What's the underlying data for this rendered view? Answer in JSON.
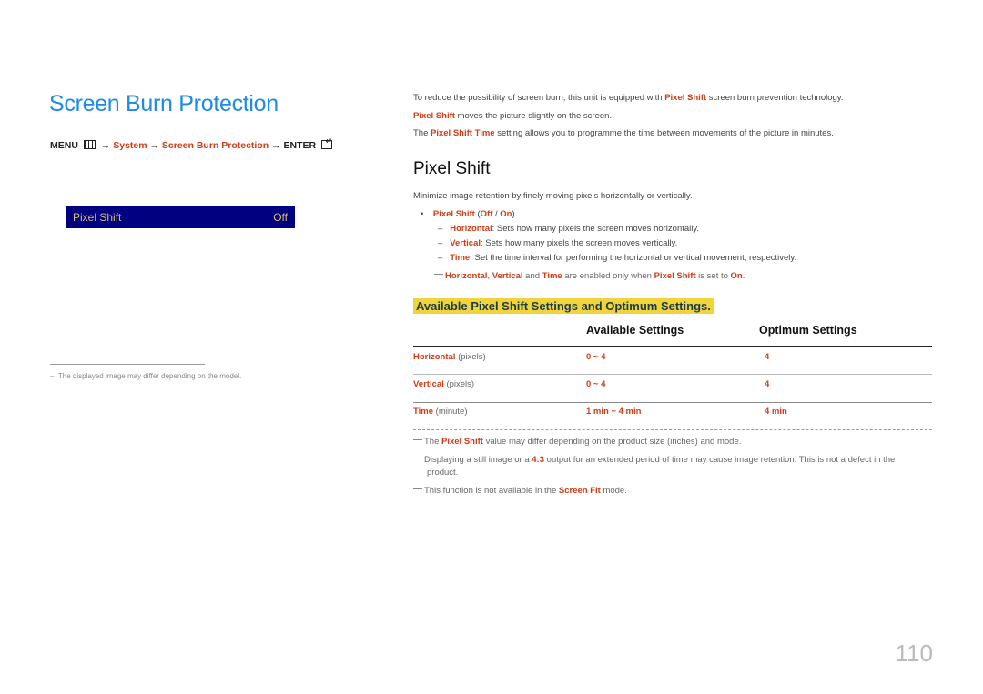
{
  "left": {
    "title": "Screen Burn Protection",
    "menu_path": {
      "menu": "MENU",
      "arrow": "→",
      "system": "System",
      "screen_burn": "Screen Burn Protection",
      "enter": "ENTER"
    },
    "osd": {
      "label": "Pixel Shift",
      "value": "Off"
    },
    "footnote": "The displayed image may differ depending on the model."
  },
  "intro": {
    "p1_a": "To reduce the possibility of screen burn, this unit is equipped with ",
    "p1_b": "Pixel Shift",
    "p1_c": " screen burn prevention technology.",
    "p2_a": "Pixel Shift",
    "p2_b": " moves the picture slightly on the screen.",
    "p3_a": "The ",
    "p3_b": "Pixel Shift Time",
    "p3_c": " setting allows you to programme the time between movements of the picture in minutes."
  },
  "section": {
    "heading": "Pixel Shift",
    "desc": "Minimize image retention by finely moving pixels horizontally or vertically.",
    "bullet": {
      "name": "Pixel Shift",
      "open": " (",
      "off": "Off",
      "sep": " / ",
      "on": "On",
      "close": ")"
    },
    "items": [
      {
        "name": "Horizontal",
        "text": ": Sets how many pixels the screen moves horizontally."
      },
      {
        "name": "Vertical",
        "text": ": Sets how many pixels the screen moves vertically."
      },
      {
        "name": "Time",
        "text": ": Set the time interval for performing the horizontal or vertical movement, respectively."
      }
    ],
    "note": {
      "h": "Horizontal",
      "c1": ", ",
      "v": "Vertical",
      "c2": " and ",
      "t": "Time",
      "c3": " are enabled only when ",
      "ps": "Pixel Shift",
      "c4": " is set to ",
      "on": "On",
      "c5": "."
    }
  },
  "table": {
    "title": "Available Pixel Shift Settings and Optimum Settings.",
    "headers": [
      "",
      "Available Settings",
      "Optimum Settings"
    ],
    "rows": [
      {
        "name": "Horizontal",
        "unit": " (pixels)",
        "available": "0 ~ 4",
        "optimum": "4"
      },
      {
        "name": "Vertical",
        "unit": " (pixels)",
        "available": "0 ~ 4",
        "optimum": "4"
      },
      {
        "name": "Time",
        "unit": " (minute)",
        "available": "1 min ~ 4 min",
        "optimum": "4 min"
      }
    ]
  },
  "notes": [
    {
      "a": "The ",
      "b": "Pixel Shift",
      "c": " value may differ depending on the product size (inches) and mode."
    },
    {
      "a": "Displaying a still image or a ",
      "b": "4:3",
      "c": " output for an extended period of time may cause image retention. This is not a defect in the",
      "d": "product."
    },
    {
      "a": "This function is not available in the ",
      "b": "Screen Fit",
      "c": " mode."
    }
  ],
  "page_number": "110"
}
